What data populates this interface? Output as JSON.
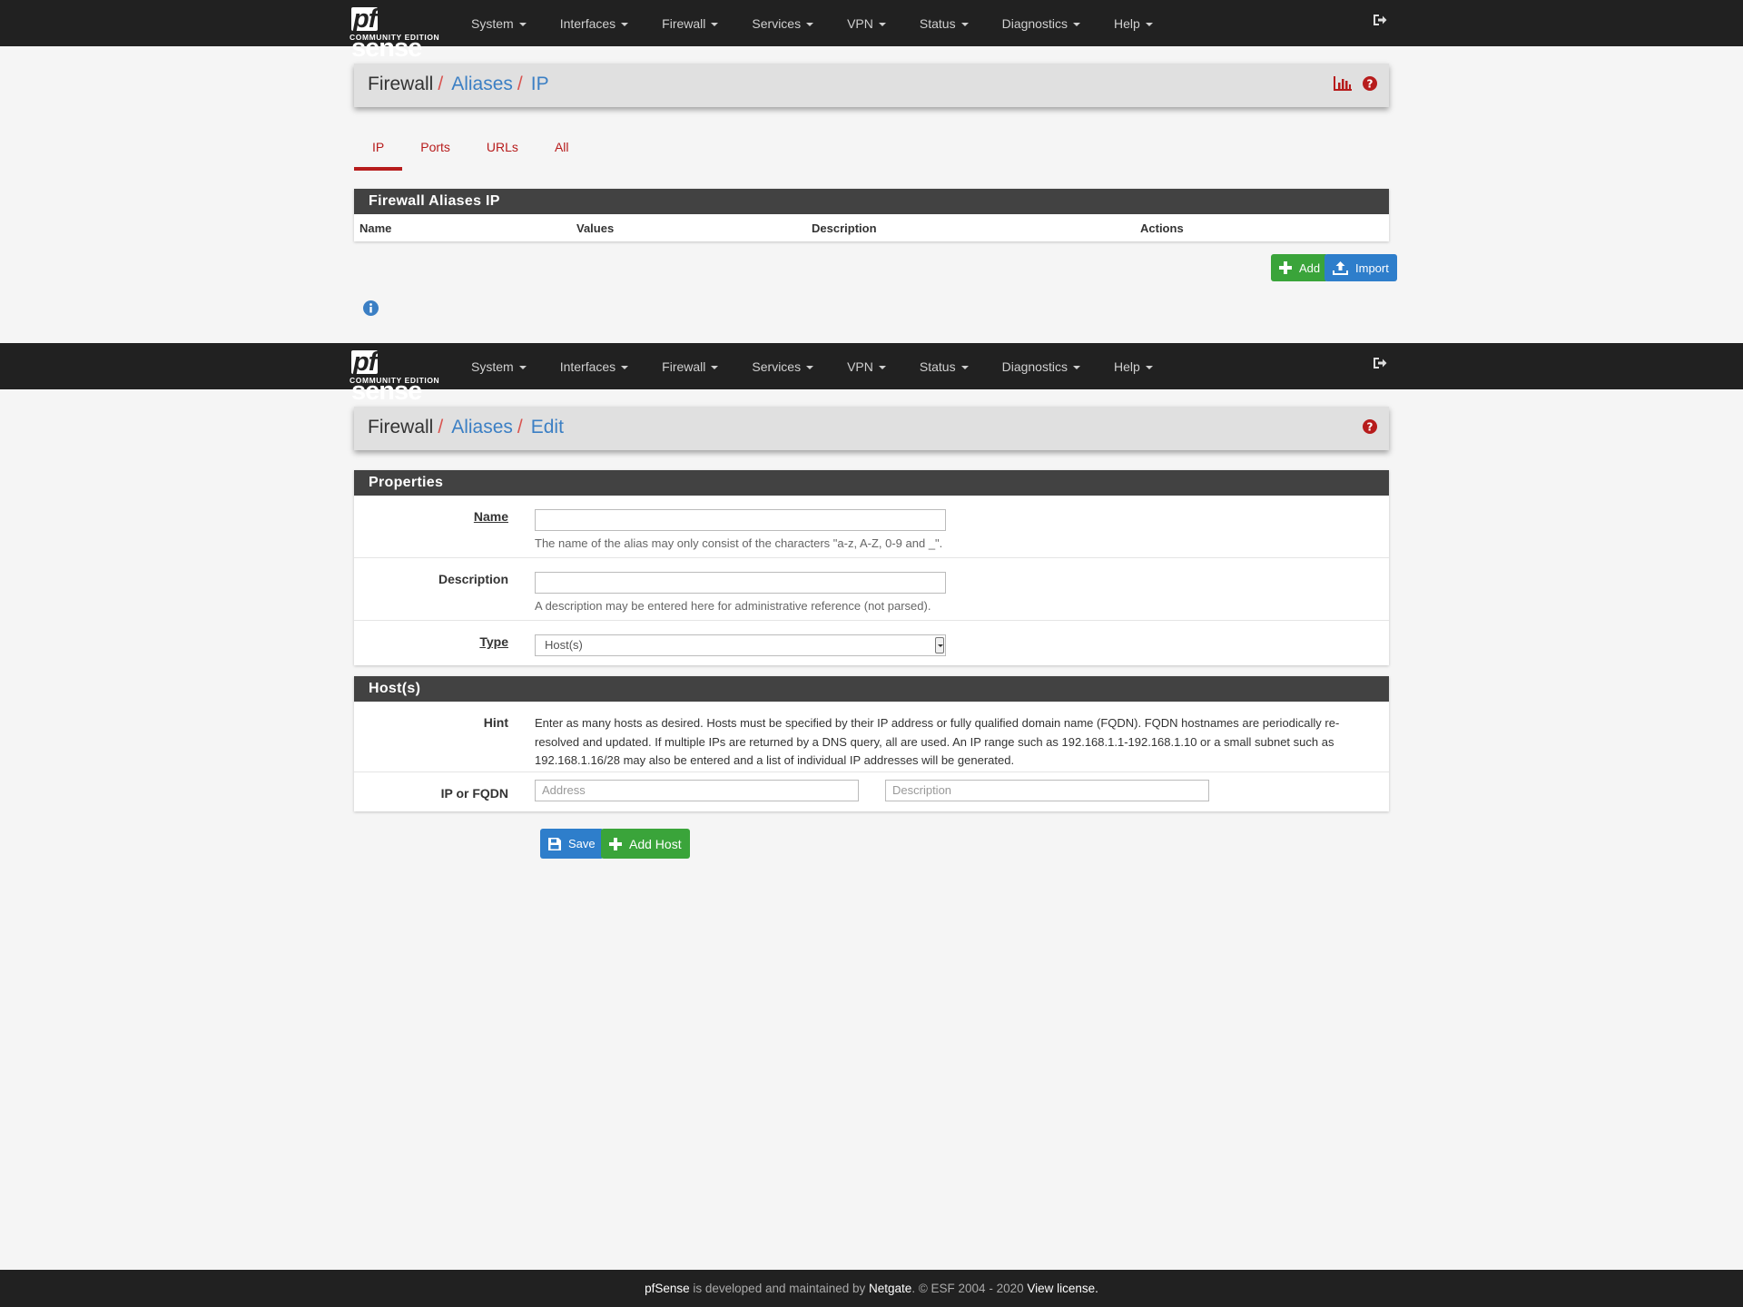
{
  "brand": {
    "logo_pf": "pf",
    "logo_sense": "sense",
    "logo_sub": "COMMUNITY EDITION"
  },
  "nav": {
    "items": [
      "System",
      "Interfaces",
      "Firewall",
      "Services",
      "VPN",
      "Status",
      "Diagnostics",
      "Help"
    ],
    "logout_icon": "sign-out-icon"
  },
  "screen1": {
    "breadcrumb": {
      "root": "Firewall",
      "sep": "/",
      "level1": "Aliases",
      "current": "IP"
    },
    "icons": {
      "chart": "bar-chart-icon",
      "help": "question-circle-icon"
    },
    "tabs": [
      "IP",
      "Ports",
      "URLs",
      "All"
    ],
    "active_tab": "IP",
    "table": {
      "title": "Firewall Aliases IP",
      "columns": [
        "Name",
        "Values",
        "Description",
        "Actions"
      ]
    },
    "buttons": {
      "add": "Add",
      "import": "Import"
    },
    "info_icon": "info-circle-icon"
  },
  "screen2": {
    "breadcrumb": {
      "root": "Firewall",
      "sep": "/",
      "level1": "Aliases",
      "current": "Edit"
    },
    "properties": {
      "title": "Properties",
      "name_label": "Name",
      "name_value": "",
      "name_help": "The name of the alias may only consist of the characters \"a-z, A-Z, 0-9 and _\".",
      "desc_label": "Description",
      "desc_value": "",
      "desc_help": "A description may be entered here for administrative reference (not parsed).",
      "type_label": "Type",
      "type_value": "Host(s)"
    },
    "hosts": {
      "title": "Host(s)",
      "hint_label": "Hint",
      "hint_text": "Enter as many hosts as desired. Hosts must be specified by their IP address or fully qualified domain name (FQDN). FQDN hostnames are periodically re-resolved and updated. If multiple IPs are returned by a DNS query, all are used. An IP range such as 192.168.1.1-192.168.1.10 or a small subnet such as 192.168.1.16/28 may also be entered and a list of individual IP addresses will be generated.",
      "ip_label": "IP or FQDN",
      "address_placeholder": "Address",
      "description_placeholder": "Description"
    },
    "buttons": {
      "save": "Save",
      "add_host": "Add Host"
    }
  },
  "footer": {
    "brand": "pfSense",
    "text1": " is developed and maintained by ",
    "company": "Netgate",
    "text2": ". © ESF 2004 - 2020 ",
    "license": "View license."
  },
  "colors": {
    "navbar": "#212121",
    "accent_red": "#b71c1c",
    "link_blue": "#3b7fc4",
    "btn_green": "#3aa43a",
    "btn_blue": "#2e7ecb"
  }
}
